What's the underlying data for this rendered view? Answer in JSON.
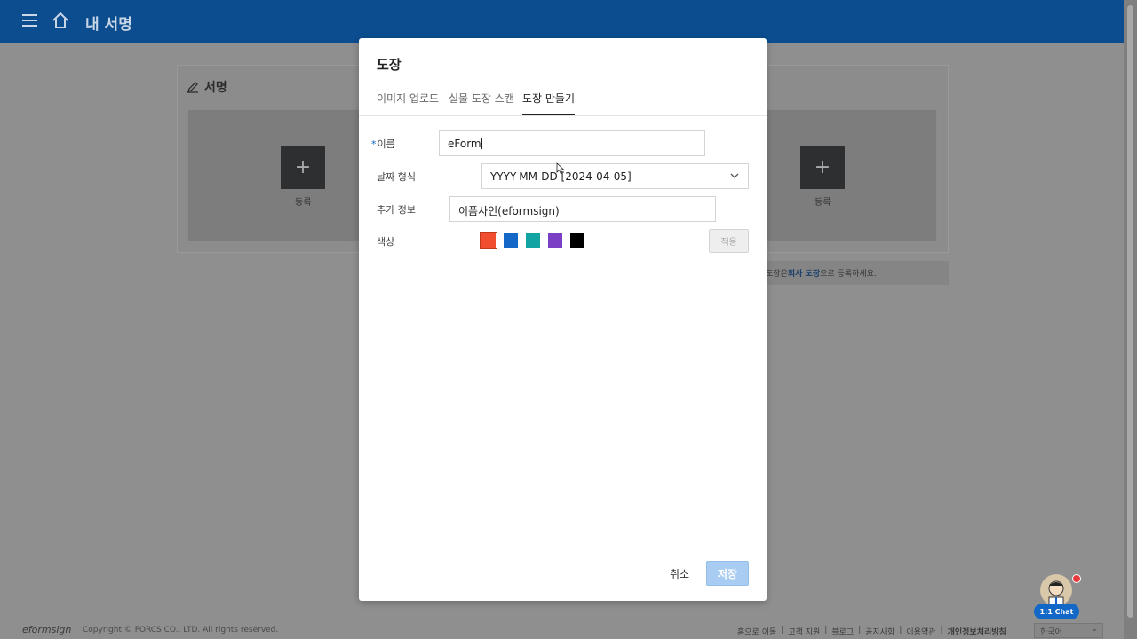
{
  "header": {
    "title": "내 서명",
    "menu_icon": "hamburger-icon",
    "home_icon": "home-icon",
    "background_color": "#0b4d8f"
  },
  "background_page": {
    "section_title": "서명",
    "section_icon": "pen-icon",
    "cards": [
      {
        "add_symbol": "+",
        "label": "등록"
      },
      {
        "add_symbol": "+",
        "label": "등록"
      }
    ],
    "notice_prefix": "도장은 ",
    "notice_link": "회사 도장",
    "notice_suffix": "으로 등록하세요."
  },
  "modal": {
    "title": "도장",
    "tabs": [
      {
        "label": "이미지 업로드",
        "active": false
      },
      {
        "label": "실물 도장 스캔",
        "active": false
      },
      {
        "label": "도장 만들기",
        "active": true
      }
    ],
    "form": {
      "name_required_mark": "*",
      "name_label": "이름",
      "name_value": "eForm",
      "date_format_label": "날짜 형식",
      "date_format_value": "YYYY-MM-DD [2024-04-05]",
      "extra_info_label": "추가 정보",
      "extra_info_value": "이폼사인(eformsign)",
      "color_label": "색상",
      "colors": [
        "#f04e2e",
        "#1367c6",
        "#12a3a3",
        "#7b3fc6",
        "#000000"
      ],
      "selected_color": "#f04e2e",
      "apply_label": "적용"
    },
    "cancel_label": "취소",
    "save_label": "저장"
  },
  "footer": {
    "logo": "eformsign",
    "copyright": "Copyright © FORCS CO., LTD. All rights reserved.",
    "links": [
      "홈으로 이동",
      "고객 지원",
      "블로그",
      "공지사항",
      "이용약관",
      "개인정보처리방침"
    ],
    "language": "한국어"
  },
  "chat": {
    "badge": "1:1 Chat",
    "accent_color": "#1367c6"
  }
}
